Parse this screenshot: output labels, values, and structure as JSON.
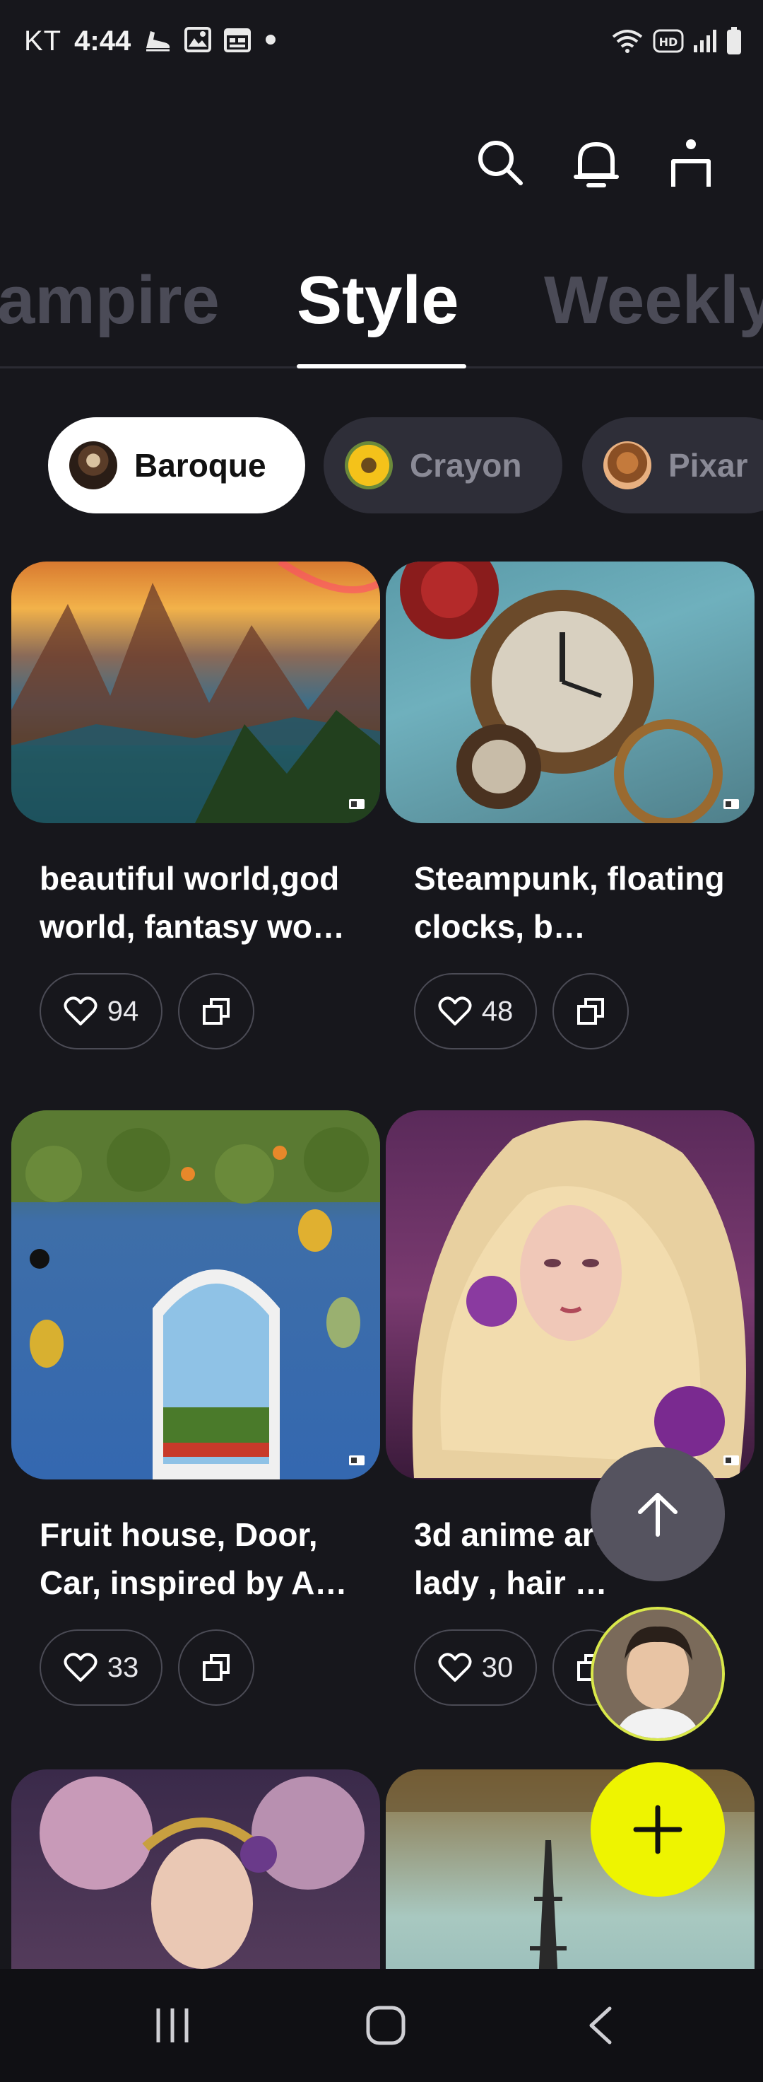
{
  "status_bar": {
    "carrier": "KT",
    "time": "4:44",
    "network_badge": "HD",
    "left_icons": [
      "sneaker-icon",
      "image-icon",
      "calendar-icon",
      "dot-icon"
    ],
    "right_icons": [
      "wifi-icon",
      "hd-icon",
      "signal-icon",
      "battery-icon"
    ]
  },
  "header": {
    "icons": [
      "search-icon",
      "bell-icon",
      "profile-icon"
    ]
  },
  "tabs": [
    {
      "label": "Vampire",
      "visible_text": "ampire",
      "active": false
    },
    {
      "label": "Style",
      "visible_text": "Style",
      "active": true
    },
    {
      "label": "Weekly",
      "visible_text": "Weekly",
      "active": false
    }
  ],
  "style_chips": [
    {
      "label": "Baroque",
      "active": true
    },
    {
      "label": "Crayon",
      "active": false
    },
    {
      "label": "Pixar",
      "active": false
    }
  ],
  "cards": [
    {
      "title": "beautiful world,god world, fantasy wo…",
      "likes": "94",
      "image": "fantasy-landscape"
    },
    {
      "title": "Steampunk, floating clocks, b…",
      "likes": "48",
      "image": "steampunk-clock"
    },
    {
      "title": "Fruit house, Door, Car, inspired by A…",
      "likes": "33",
      "image": "fruit-house-door"
    },
    {
      "title": "3d anime art noble  lady , hair …",
      "likes": "30",
      "image": "anime-noble-lady"
    },
    {
      "title": "",
      "likes": "",
      "image": "baroque-portrait"
    },
    {
      "title": "",
      "likes": "",
      "image": "eiffel-tower"
    }
  ],
  "fabs": {
    "scroll_top": "arrow-up-icon",
    "profile": "user-avatar",
    "create": "plus-icon"
  },
  "colors": {
    "background": "#17171c",
    "chip_active": "#ffffff",
    "chip_inactive": "#2e2e38",
    "accent_yellow": "#eef400",
    "fab_gray": "#55535f"
  },
  "nav_bar": {
    "icons": [
      "recent-apps-icon",
      "home-icon",
      "back-icon"
    ]
  }
}
